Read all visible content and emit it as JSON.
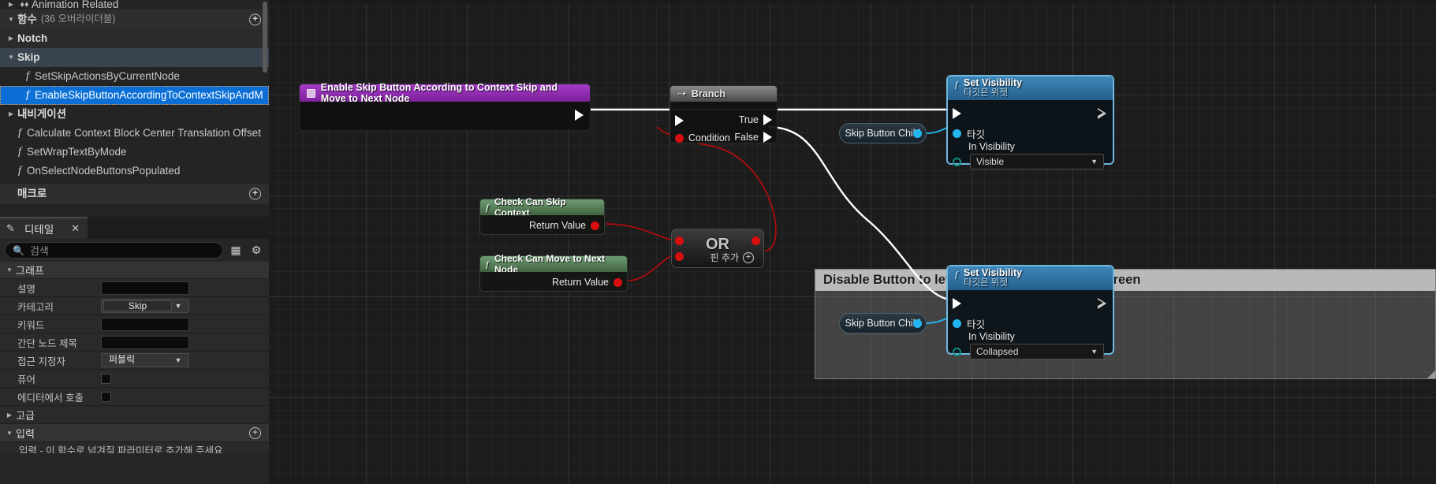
{
  "sidebar": {
    "tree": {
      "rows": [
        {
          "label": "Animation Related",
          "indent": 1,
          "tri": "right",
          "kind": "category-cut",
          "icon": "animation-icon"
        },
        {
          "label": "함수",
          "sub": "(36 오버라이더블)",
          "indent": 1,
          "tri": "down",
          "kind": "section",
          "add_button": true
        },
        {
          "label": "Notch",
          "indent": 1,
          "tri": "right",
          "kind": "category"
        },
        {
          "label": "Skip",
          "indent": 1,
          "tri": "down",
          "kind": "category-open"
        },
        {
          "label": "SetSkipActionsByCurrentNode",
          "indent": 2,
          "tri": "none",
          "kind": "function"
        },
        {
          "label": "EnableSkipButtonAccordingToContextSkipAndM",
          "indent": 2,
          "tri": "none",
          "kind": "function-selected"
        },
        {
          "label": "내비게이션",
          "indent": 1,
          "tri": "right",
          "kind": "category"
        },
        {
          "label": "Calculate Context Block Center Translation Offset",
          "indent": 3,
          "tri": "none",
          "kind": "function"
        },
        {
          "label": "SetWrapTextByMode",
          "indent": 3,
          "tri": "none",
          "kind": "function"
        },
        {
          "label": "OnSelectNodeButtonsPopulated",
          "indent": 3,
          "tri": "none",
          "kind": "function"
        },
        {
          "label": "매크로",
          "indent": 1,
          "tri": "none",
          "kind": "section",
          "add_button": true
        }
      ]
    },
    "details": {
      "tab_label": "디테일",
      "tab_icon": "pencil-icon",
      "close_icon": "close-icon",
      "search_placeholder": "검색",
      "search_value": "",
      "toolbar_icons": [
        "grid-view-icon",
        "gear-icon"
      ],
      "sections": [
        {
          "label": "그래프",
          "expanded": true
        }
      ],
      "properties": [
        {
          "label": "설명",
          "type": "text",
          "value": ""
        },
        {
          "label": "카테고리",
          "type": "combo-boxed",
          "value": "Skip"
        },
        {
          "label": "키워드",
          "type": "text",
          "value": ""
        },
        {
          "label": "간단 노드 제목",
          "type": "text",
          "value": ""
        },
        {
          "label": "접근 지정자",
          "type": "combo",
          "value": "퍼블릭"
        },
        {
          "label": "퓨어",
          "type": "checkbox",
          "value": ""
        },
        {
          "label": "에디터에서 호출",
          "type": "checkbox",
          "value": ""
        }
      ],
      "footer_sections": [
        {
          "label": "고급",
          "expanded": false,
          "add_button": false
        },
        {
          "label": "입력",
          "expanded": true,
          "add_button": true
        }
      ],
      "cutoff_hint": "입력 - 이 함수로 넘겨질 파라미터로 추가해 주세요"
    }
  },
  "graph": {
    "nodes": [
      {
        "id": "entry",
        "title": "Enable Skip Button According to Context Skip and Move to Next Node",
        "kind": "function-entry",
        "header_color": "#8e2bb0",
        "icon": "function-entry-icon",
        "out_exec": true
      },
      {
        "id": "branch",
        "title": "Branch",
        "kind": "flow-control",
        "header_color": "#5a5a5a",
        "icon": "branch-icon",
        "in_exec": true,
        "in_pins": [
          {
            "label": "Condition",
            "type": "bool"
          }
        ],
        "out_pins": [
          {
            "label": "True",
            "type": "exec"
          },
          {
            "label": "False",
            "type": "exec"
          }
        ]
      },
      {
        "id": "set-visibility-1",
        "title": "Set Visibility",
        "subtitle": "타깃은 위젯",
        "kind": "function-call",
        "header_color": "#2a6a99",
        "icon": "function-icon",
        "target_pin": "타깃",
        "prop_label": "In Visibility",
        "prop_value": "Visible"
      },
      {
        "id": "skip-button-child-1",
        "title": "Skip Button Child",
        "kind": "variable-get",
        "out_type": "object"
      },
      {
        "id": "check-can-skip-context",
        "title": "Check Can Skip Context",
        "kind": "function-call-pure",
        "header_color": "#4d7a53",
        "icon": "function-icon",
        "out_pins": [
          {
            "label": "Return Value",
            "type": "bool"
          }
        ]
      },
      {
        "id": "check-can-move-to-next-node",
        "title": "Check Can Move to Next Node",
        "kind": "function-call-pure",
        "header_color": "#4d7a53",
        "icon": "function-icon",
        "out_pins": [
          {
            "label": "Return Value",
            "type": "bool"
          }
        ]
      },
      {
        "id": "or-node",
        "title": "OR",
        "add_pin_label": "핀 추가",
        "kind": "operator",
        "in_pins": 2,
        "out_pins": 1
      },
      {
        "id": "set-visibility-2",
        "title": "Set Visibility",
        "subtitle": "타깃은 위젯",
        "kind": "function-call",
        "header_color": "#2a6a99",
        "icon": "function-icon",
        "target_pin": "타깃",
        "prop_label": "In Visibility",
        "prop_value": "Collapsed"
      },
      {
        "id": "skip-button-child-2",
        "title": "Skip Button Child",
        "kind": "variable-get",
        "out_type": "object"
      }
    ],
    "comment": {
      "text": "Disable Button to let player interact with the screen"
    }
  },
  "colors": {
    "exec_wire": "#ffffff",
    "bool_wire": "#b30c0c",
    "object_wire": "#1fb4ea",
    "selection": "#0b6fd6",
    "entry_header": "#8e2bb0",
    "pure_header": "#4d7a53",
    "call_header": "#2a6a99"
  }
}
